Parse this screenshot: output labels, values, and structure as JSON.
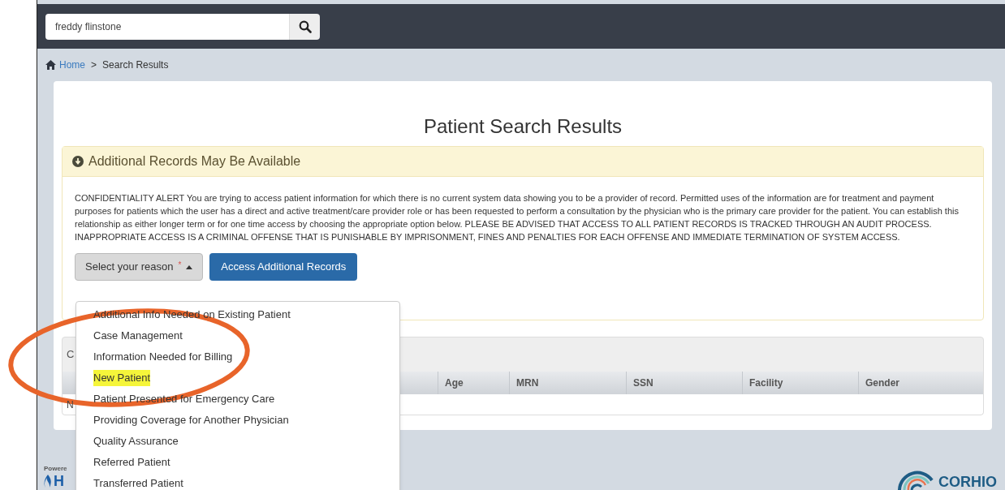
{
  "search": {
    "value": "freddy flinstone"
  },
  "breadcrumb": {
    "home": "Home",
    "separator": ">",
    "current": "Search Results"
  },
  "title": "Patient Search Results",
  "alert": {
    "heading": "Additional Records May Be Available",
    "message": "CONFIDENTIALITY ALERT You are trying to access patient information for which there is no current system data showing you to be a provider of record. Permitted uses of the information are for treatment and payment purposes for patients which the user has a direct and active treatment/care provider role or has been requested to perform a consultation by the physician who is the primary care provider for the patient. You can establish this relationship as either longer term or for one time access by choosing the appropriate option below. PLEASE BE ADVISED THAT ACCESS TO ALL PATIENT RECORDS IS TRACKED THROUGH AN AUDIT PROCESS. INAPPROPRIATE ACCESS IS A CRIMINAL OFFENSE THAT IS PUNISHABLE BY IMPRISONMENT, FINES AND PENALTIES FOR EACH OFFENSE AND IMMEDIATE TERMINATION OF SYSTEM ACCESS.",
    "select": {
      "label": "Select your reason",
      "required_mark": "*",
      "expanded": true
    },
    "button": "Access Additional Records"
  },
  "dropdown": [
    {
      "label": "Additional Info Needed on Existing Patient",
      "highlighted": false
    },
    {
      "label": "Case Management",
      "highlighted": false
    },
    {
      "label": "Information Needed for Billing",
      "highlighted": false
    },
    {
      "label": "New Patient",
      "highlighted": true
    },
    {
      "label": "Patient Presented for Emergency Care",
      "highlighted": false
    },
    {
      "label": "Providing Coverage for Another Physician",
      "highlighted": false
    },
    {
      "label": "Quality Assurance",
      "highlighted": false
    },
    {
      "label": "Referred Patient",
      "highlighted": false
    },
    {
      "label": "Transferred Patient",
      "highlighted": false
    }
  ],
  "results": {
    "heading": "C",
    "columns": [
      "Age",
      "MRN",
      "SSN",
      "Facility",
      "Gender"
    ],
    "empty_row": "N"
  },
  "footer": {
    "powered": "Powere",
    "logo_letter": "H",
    "brand": "CORHIO"
  }
}
